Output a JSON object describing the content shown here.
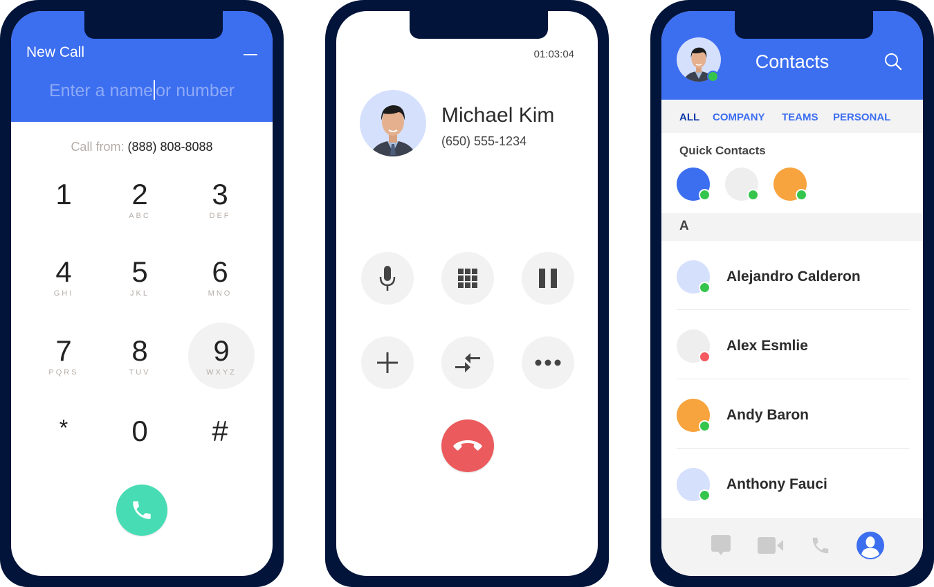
{
  "colors": {
    "brand_blue": "#3c6ef0",
    "frame_navy": "#02143a",
    "call_green": "#47dcb4",
    "end_red": "#eb5a5c",
    "online_green": "#35c54d",
    "busy_red": "#f45a5f",
    "avatar_lavender": "#d5e0fd",
    "avatar_grey": "#eeeeee",
    "avatar_orange": "#f7a33e"
  },
  "dialer": {
    "title": "New Call",
    "minimize_icon": "minus-icon",
    "input_text_before_caret": "Enter a name",
    "input_text_after_caret": "or number",
    "call_from_label": "Call from:",
    "call_from_number": "(888) 808-8088",
    "keys": [
      {
        "digit": "1",
        "letters": ""
      },
      {
        "digit": "2",
        "letters": "ABC"
      },
      {
        "digit": "3",
        "letters": "DEF"
      },
      {
        "digit": "4",
        "letters": "GHI"
      },
      {
        "digit": "5",
        "letters": "JKL"
      },
      {
        "digit": "6",
        "letters": "MNO"
      },
      {
        "digit": "7",
        "letters": "PQRS"
      },
      {
        "digit": "8",
        "letters": "TUV"
      },
      {
        "digit": "9",
        "letters": "WXYZ"
      },
      {
        "digit": "*",
        "letters": ""
      },
      {
        "digit": "0",
        "letters": ""
      },
      {
        "digit": "#",
        "letters": ""
      }
    ],
    "pressed_key": "9",
    "call_button_icon": "phone-icon"
  },
  "in_call": {
    "timer": "01:03:04",
    "callee_name": "Michael Kim",
    "callee_phone": "(650) 555-1234",
    "controls": [
      {
        "name": "mute",
        "icon": "microphone-icon"
      },
      {
        "name": "keypad",
        "icon": "keypad-grid-icon"
      },
      {
        "name": "hold",
        "icon": "pause-icon"
      },
      {
        "name": "add-call",
        "icon": "plus-icon"
      },
      {
        "name": "merge",
        "icon": "merge-arrows-icon"
      },
      {
        "name": "more",
        "icon": "more-dots-icon"
      }
    ],
    "end_call_icon": "hang-up-icon"
  },
  "contacts": {
    "title": "Contacts",
    "search_icon": "search-icon",
    "tabs": [
      {
        "label": "ALL",
        "active": true
      },
      {
        "label": "COMPANY",
        "active": false
      },
      {
        "label": "TEAMS",
        "active": false
      },
      {
        "label": "PERSONAL",
        "active": false
      }
    ],
    "quick_contacts_label": "Quick Contacts",
    "quick_contacts": [
      {
        "color": "#3c6ef0",
        "status": "online"
      },
      {
        "color": "#eeeeee",
        "status": "online"
      },
      {
        "color": "#f7a33e",
        "status": "online"
      }
    ],
    "section_letter": "A",
    "list": [
      {
        "name": "Alejandro Calderon",
        "color": "#d5e0fd",
        "status": "online"
      },
      {
        "name": "Alex Esmlie",
        "color": "#eeeeee",
        "status": "busy"
      },
      {
        "name": "Andy Baron",
        "color": "#f7a33e",
        "status": "online"
      },
      {
        "name": "Anthony Fauci",
        "color": "#d5e0fd",
        "status": "online"
      }
    ],
    "bottom_nav": [
      {
        "name": "messages",
        "icon": "chat-bubble-icon",
        "active": false
      },
      {
        "name": "video",
        "icon": "video-camera-icon",
        "active": false
      },
      {
        "name": "calls",
        "icon": "phone-icon",
        "active": false
      },
      {
        "name": "contacts",
        "icon": "person-icon",
        "active": true
      }
    ]
  }
}
